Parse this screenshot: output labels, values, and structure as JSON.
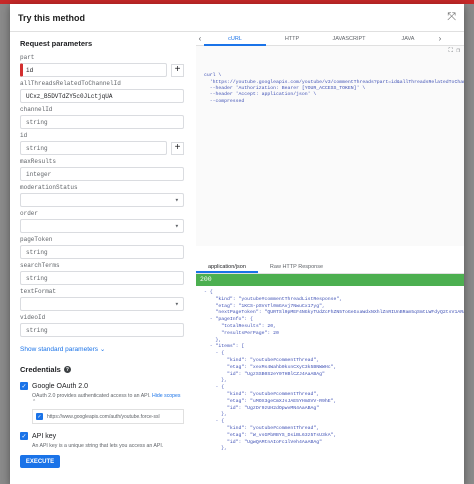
{
  "dialog": {
    "title": "Try this method"
  },
  "request": {
    "section_title": "Request parameters",
    "params": [
      {
        "name": "part",
        "value": "id",
        "filled": true
      },
      {
        "name": "allThreadsRelatedToChannelId",
        "value": "UCxz_B5DVTdZY5c0JLctjqUA",
        "filled": true
      },
      {
        "name": "channelId",
        "value": "string"
      },
      {
        "name": "id",
        "value": "string"
      },
      {
        "name": "maxResults",
        "value": "integer"
      },
      {
        "name": "moderationStatus",
        "value": ""
      },
      {
        "name": "order",
        "value": ""
      },
      {
        "name": "pageToken",
        "value": "string"
      },
      {
        "name": "searchTerms",
        "value": "string"
      },
      {
        "name": "textFormat",
        "value": ""
      },
      {
        "name": "videoId",
        "value": "string"
      }
    ],
    "show_standard": "Show standard parameters"
  },
  "credentials": {
    "title": "Credentials",
    "oauth_label": "Google OAuth 2.0",
    "oauth_desc": "OAuth 2.0 provides authenticated access to an API.",
    "oauth_hide": "Hide scopes",
    "scope_url": "https://www.googleapis.com/auth/youtube.force-ssl",
    "apikey_label": "API key",
    "apikey_desc": "An API key is a unique string that lets you access an API.",
    "execute": "EXECUTE"
  },
  "code_tabs": [
    "cURL",
    "HTTP",
    "JAVASCRIPT",
    "JAVA"
  ],
  "curl": "curl \\\n  'https://youtube.googleapis.com/youtube/v3/commentThreads?part=id&allThreadsRelatedToChanne\n  --header 'Authorization: Bearer [YOUR_ACCESS_TOKEN]' \\\n  --header 'Accept: application/json' \\\n  --compressed",
  "response_tabs": [
    "application/json",
    "Raw HTTP Response"
  ],
  "status_code": "200",
  "response_json": "- {\n    \"kind\": \"youtube#commentThreadListResponse\",\n    \"etag\": \"1KCS-pSVsTl0mGAvj7NwuCx17yg\",\n    \"nextPageToken\": \"QURTSl9pMEF4NGkyTUdZcFhZN5ToGeGxaWdxNXhlZnRIUnBRam5qSmtLWFdyQ2tsV1ARaWyYiRnFLLkc\",\n  - \"pageInfo\": {\n      \"totalResults\": 20,\n      \"resultsPerPage\": 20\n    },\n  - \"items\": [\n    - {\n        \"kind\": \"youtube#commentThread\",\n        \"etag\": \"xexMs4Wahb0kxnCXyC3k5BNWWHc\",\n        \"id\": \"UgzSSB0S2eY0THBlCZJ4AaABAg\"\n      },\n    - {\n        \"kind\": \"youtube#commentThread\",\n        \"etag\": \"uMOX3geCmXJsJAE5YHmSVV-R9hE\",\n        \"id\": \"UgzDr9zUH2dOpwvMN4AaABAg\"\n      },\n    - {\n        \"kind\": \"youtube#commentThread\",\n        \"etag\": \"W_vsGPbRBYS_DsiBL63z5TsU3kA\",\n        \"id\": \"UgwQAMtnAIoFc1lVeh4AaABAg\"\n      },"
}
